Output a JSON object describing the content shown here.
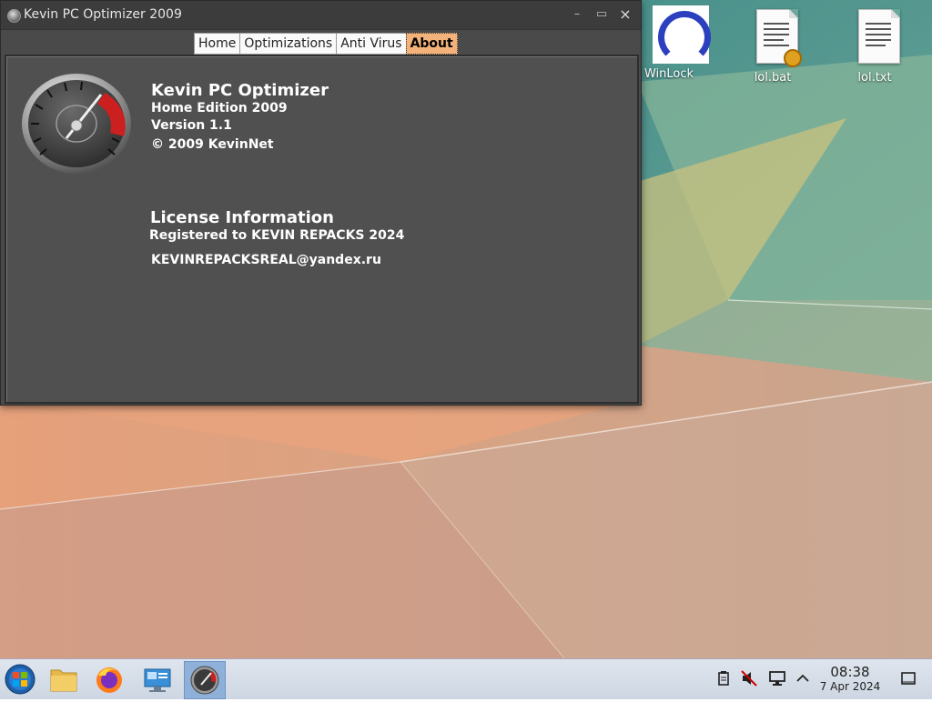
{
  "window": {
    "title": "Kevin PC Optimizer 2009",
    "controls": {
      "minimize": "–",
      "maximize": "▭",
      "close": "×"
    }
  },
  "tabs": [
    {
      "label": "Home",
      "active": false
    },
    {
      "label": "Optimizations",
      "active": false
    },
    {
      "label": "Anti Virus",
      "active": false
    },
    {
      "label": "About",
      "active": true
    }
  ],
  "about": {
    "product_name": "Kevin PC Optimizer",
    "edition": "Home Edition 2009",
    "version": "Version 1.1",
    "copyright": "© 2009 KevinNet",
    "license_heading": "License Information",
    "registered_to": "Registered to KEVIN REPACKS 2024",
    "email": "KEVINREPACKSREAL@yandex.ru"
  },
  "desktop_icons": [
    {
      "label": "WinLock",
      "icon": "winlock-icon"
    },
    {
      "label": "lol.bat",
      "icon": "batch-file-icon"
    },
    {
      "label": "lol.txt",
      "icon": "text-file-icon"
    }
  ],
  "taskbar": {
    "apps": [
      {
        "name": "start",
        "icon": "windows-start-icon"
      },
      {
        "name": "files",
        "icon": "folder-icon"
      },
      {
        "name": "firefox",
        "icon": "firefox-icon"
      },
      {
        "name": "system",
        "icon": "computer-icon"
      },
      {
        "name": "optimizer",
        "icon": "gauge-icon"
      }
    ],
    "clock_time": "08:38",
    "clock_date": "7 Apr 2024"
  },
  "colors": {
    "active_tab": "#f2b27a",
    "panel": "#505050",
    "gauge_red": "#cc1f1f"
  }
}
